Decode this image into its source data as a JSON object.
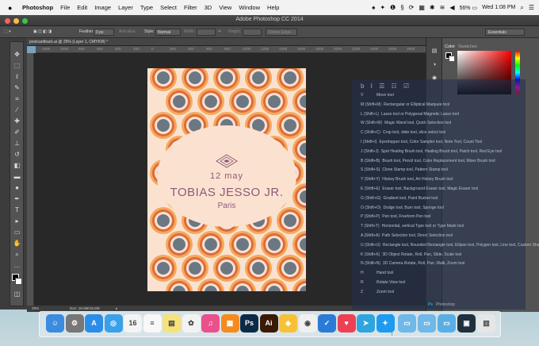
{
  "menubar": {
    "apple": "",
    "items": [
      "Photoshop",
      "File",
      "Edit",
      "Image",
      "Layer",
      "Type",
      "Select",
      "Filter",
      "3D",
      "View",
      "Window",
      "Help"
    ],
    "battery": "56%",
    "clock": "Wed 1:08 PM"
  },
  "window": {
    "title": "Adobe Photoshop CC 2014"
  },
  "options": {
    "feather_label": "Feather:",
    "feather_value": "0 px",
    "antialias": "Anti-alias",
    "style_label": "Style:",
    "style_value": "Normal",
    "width_label": "Width:",
    "height_label": "Height:",
    "refine": "Refine Edge...",
    "workspace": "Essentials"
  },
  "document": {
    "tab": "postcardback.ai @ 25% (Layer 1, CMYK/8) *"
  },
  "ruler": [
    "1000",
    "1000",
    "800",
    "600",
    "400",
    "200",
    "0",
    "200",
    "400",
    "600",
    "800",
    "1000",
    "1200",
    "1400",
    "1600",
    "1800",
    "2000",
    "2200",
    "2400",
    "2600",
    "2800",
    "3000"
  ],
  "poster": {
    "date": "12 may",
    "artist": "TOBIAS JESSO JR.",
    "city": "Paris"
  },
  "status": {
    "zoom": "25%",
    "doc": "Doc: 16.6M/16.6M"
  },
  "panels": {
    "color_tab": "Color",
    "swatches_tab": "Swatches",
    "bottom_label": "Photoshop"
  },
  "shortcuts": [
    [
      "V",
      "Move tool"
    ],
    [
      "M (Shift+M)",
      "Rectangular or Elliptical Marquee tool"
    ],
    [
      "L (Shift+L)",
      "Lasso tool or Polygonal Magnetic Lasso tool"
    ],
    [
      "W (Shift+W)",
      "Magic Wand tool, Quick Selection tool"
    ],
    [
      "C (Shift+C)",
      "Crop tool, slide tool, slice select tool"
    ],
    [
      "I (Shift+I)",
      "Eyedropper tool, Color Sampler tool, Note Tool, Count Tool"
    ],
    [
      "J (Shift+J)",
      "Spot Healing Brush tool, Healing Brush tool, Patch tool, Red Eye tool"
    ],
    [
      "B (Shift+B)",
      "Brush tool, Pencil tool, Color Replacement tool, Mixer Brush tool"
    ],
    [
      "S (Shift+S)",
      "Clone Stamp tool, Pattern Stamp tool"
    ],
    [
      "Y (Shift+Y)",
      "History Brush tool, Art History Brush tool"
    ],
    [
      "E (Shift+E)",
      "Eraser tool, Background Eraser tool, Magic Eraser tool"
    ],
    [
      "G (Shift+G)",
      "Gradient tool, Paint Bucket tool"
    ],
    [
      "O (Shift+O)",
      "Dodge tool, Burn tool, Sponge tool"
    ],
    [
      "P (Shift+P)",
      "Pen tool, Freeform Pen tool"
    ],
    [
      "T (Shift+T)",
      "Horizontal, vertical Type tool or Type Mask tool"
    ],
    [
      "A (Shift+A)",
      "Path Selection tool, Direct Selection tool"
    ],
    [
      "U (Shift+U)",
      "Rectangle tool, Rounded Rectangle tool, Ellipse tool, Polygon tool, Line tool, Custom Shape tool"
    ],
    [
      "K (Shift+K)",
      "3D Object Rotate, Roll, Pan, Slide, Scale tool"
    ],
    [
      "N (Shift+N)",
      "3D Camera Rotate, Roll, Pan, Walk, Zoom tool"
    ],
    [
      "H",
      "Hand tool"
    ],
    [
      "R",
      "Rotate View tool"
    ],
    [
      "Z",
      "Zoom tool"
    ]
  ],
  "dock": [
    {
      "name": "finder-icon",
      "glyph": "☺",
      "color": "#3b8be0"
    },
    {
      "name": "system-prefs-icon",
      "glyph": "⚙",
      "color": "#777"
    },
    {
      "name": "app-store-icon",
      "glyph": "A",
      "color": "#2a8ee8"
    },
    {
      "name": "safari-icon",
      "glyph": "◎",
      "color": "#3aa0e8"
    },
    {
      "name": "calendar-icon",
      "glyph": "16",
      "color": "#f4f4f4"
    },
    {
      "name": "reminders-icon",
      "glyph": "≡",
      "color": "#f8f8f8"
    },
    {
      "name": "notes-icon",
      "glyph": "▤",
      "color": "#f5e27a"
    },
    {
      "name": "photos-icon",
      "glyph": "✿",
      "color": "#f3f3f3"
    },
    {
      "name": "itunes-icon",
      "glyph": "♫",
      "color": "#e9508c"
    },
    {
      "name": "ibooks-icon",
      "glyph": "▦",
      "color": "#f38b1f"
    },
    {
      "name": "photoshop-icon",
      "glyph": "Ps",
      "color": "#0c2a45"
    },
    {
      "name": "illustrator-icon",
      "glyph": "Ai",
      "color": "#3a1a05"
    },
    {
      "name": "sketch-icon",
      "glyph": "◆",
      "color": "#f7c137"
    },
    {
      "name": "chrome-icon",
      "glyph": "◉",
      "color": "#f0f0f0"
    },
    {
      "name": "wunderlist-icon",
      "glyph": "✓",
      "color": "#2b7bd6"
    },
    {
      "name": "pocket-icon",
      "glyph": "♥",
      "color": "#ee4055"
    },
    {
      "name": "telegram-icon",
      "glyph": "➤",
      "color": "#2ea5de"
    },
    {
      "name": "twitter-icon",
      "glyph": "✦",
      "color": "#1d9bf0"
    },
    {
      "name": "folder-icon",
      "glyph": "▭",
      "color": "#6fb8e8"
    },
    {
      "name": "folder-icon",
      "glyph": "▭",
      "color": "#6fb8e8"
    },
    {
      "name": "downloads-folder-icon",
      "glyph": "▭",
      "color": "#5aaee6"
    },
    {
      "name": "screen-icon",
      "glyph": "▣",
      "color": "#20303e"
    },
    {
      "name": "trash-icon",
      "glyph": "▥",
      "color": "#e6e6e6"
    }
  ]
}
